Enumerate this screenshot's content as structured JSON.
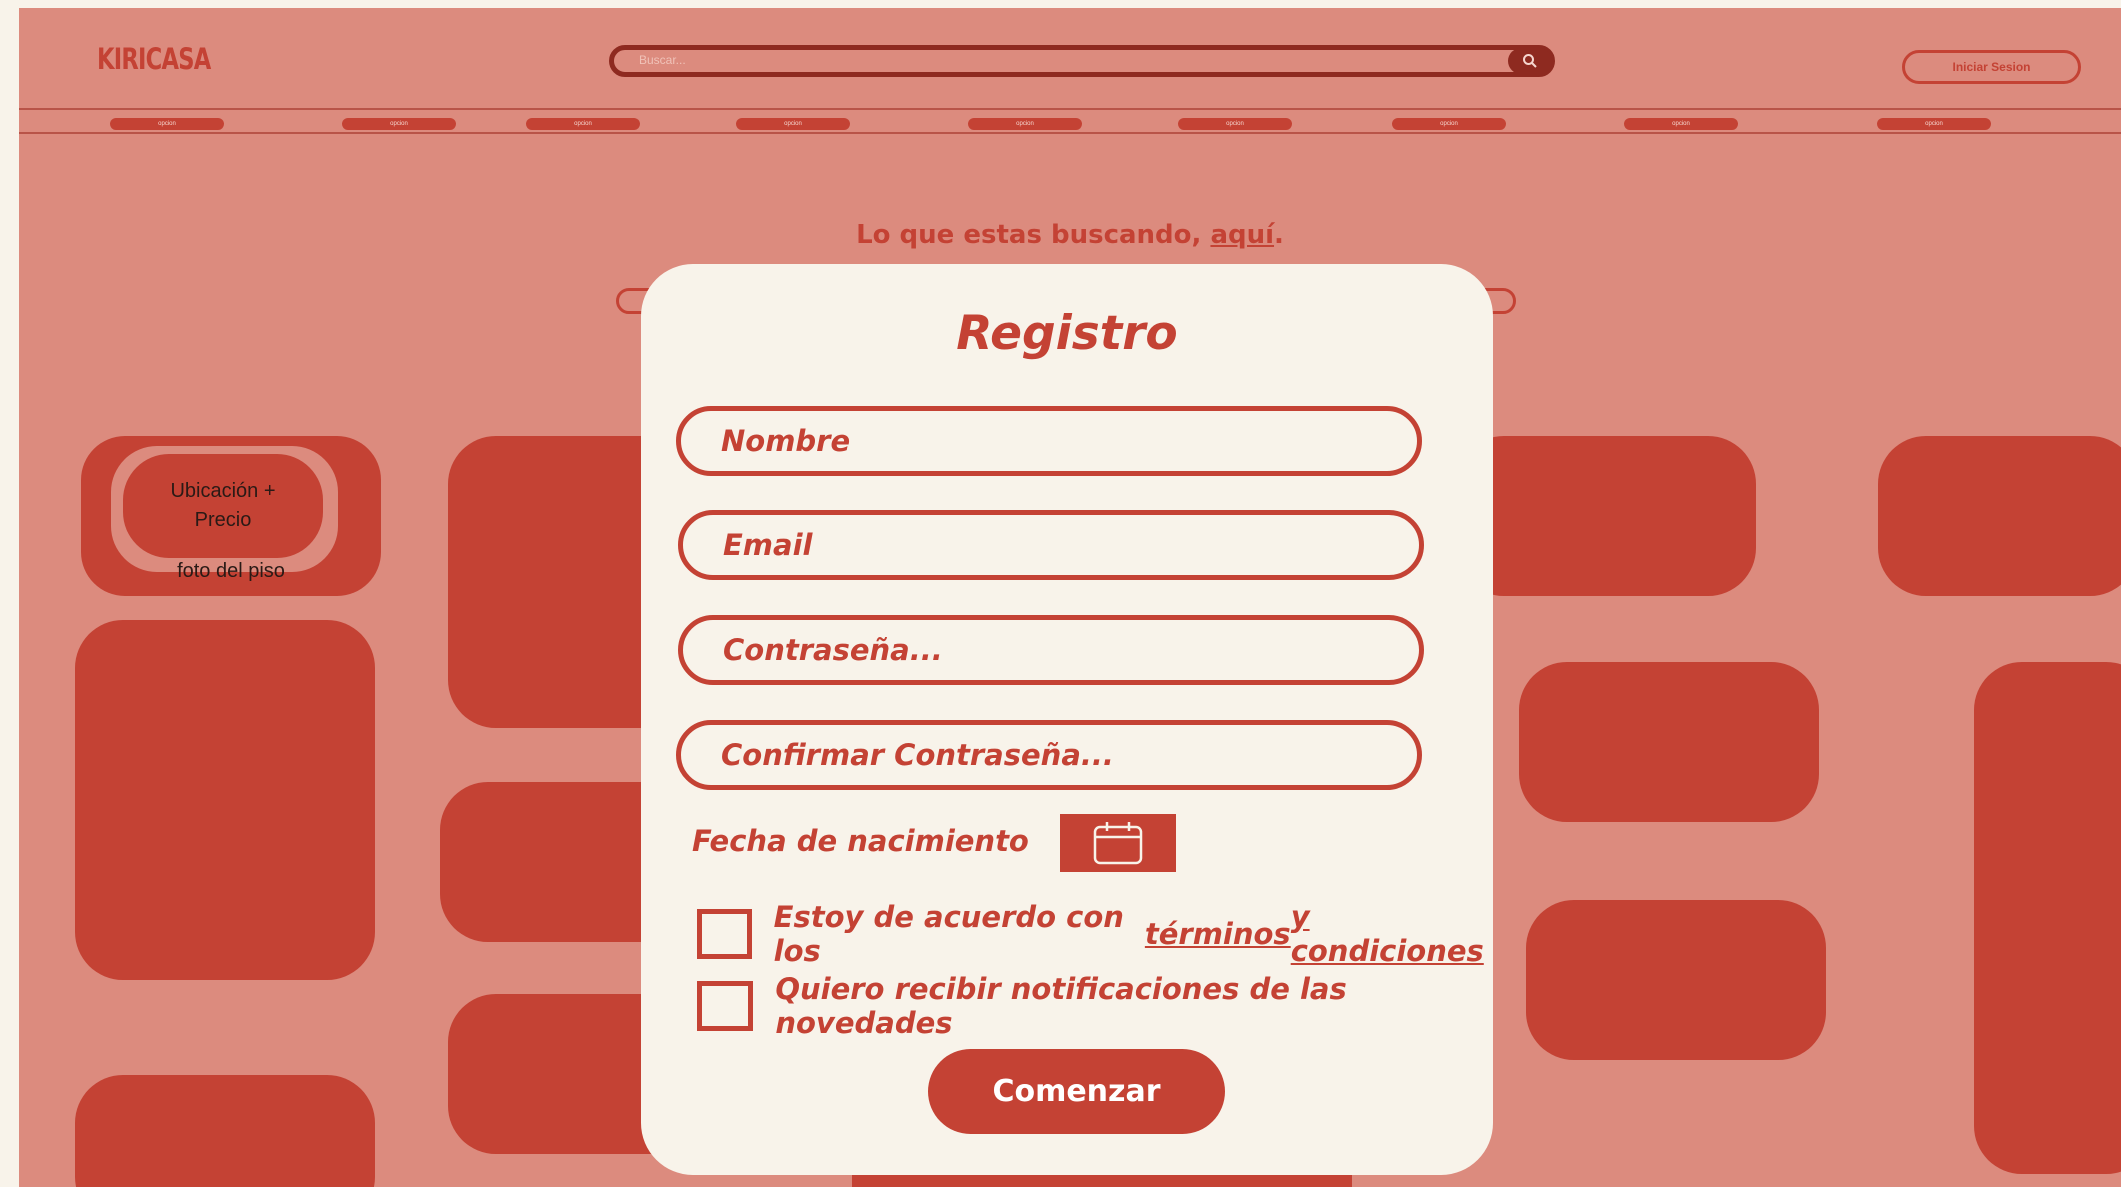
{
  "header": {
    "logo": "KIRICASA",
    "search": {
      "placeholder": "Buscar..."
    },
    "login_label": "Iniciar Sesion",
    "nav_items": [
      "opcion",
      "opcion",
      "opcion",
      "opcion",
      "opcion",
      "opcion",
      "opcion",
      "opcion",
      "opcion"
    ]
  },
  "hero": {
    "tagline_prefix": "Lo que estas buscando, ",
    "tagline_link": "aquí",
    "tagline_suffix": "."
  },
  "feature_card": {
    "title": "Ubicación + Precio",
    "caption": "foto del piso"
  },
  "modal": {
    "title": "Registro",
    "fields": [
      "Nombre",
      "Email",
      "Contraseña...",
      "Confirmar Contraseña..."
    ],
    "dob_label": "Fecha de nacimiento",
    "terms_prefix": "Estoy de acuerdo con los ",
    "terms_link_1": "términos",
    "terms_link_sep": " ",
    "terms_link_2": "y condiciones",
    "notifications_label": "Quiero recibir notificaciones de las novedades",
    "submit_label": "Comenzar"
  },
  "colors": {
    "background": "#dc8b7e",
    "accent": "#c44234",
    "modal": "#f8f3ea"
  },
  "icons": {
    "search": "search-icon",
    "calendar": "calendar-icon"
  }
}
